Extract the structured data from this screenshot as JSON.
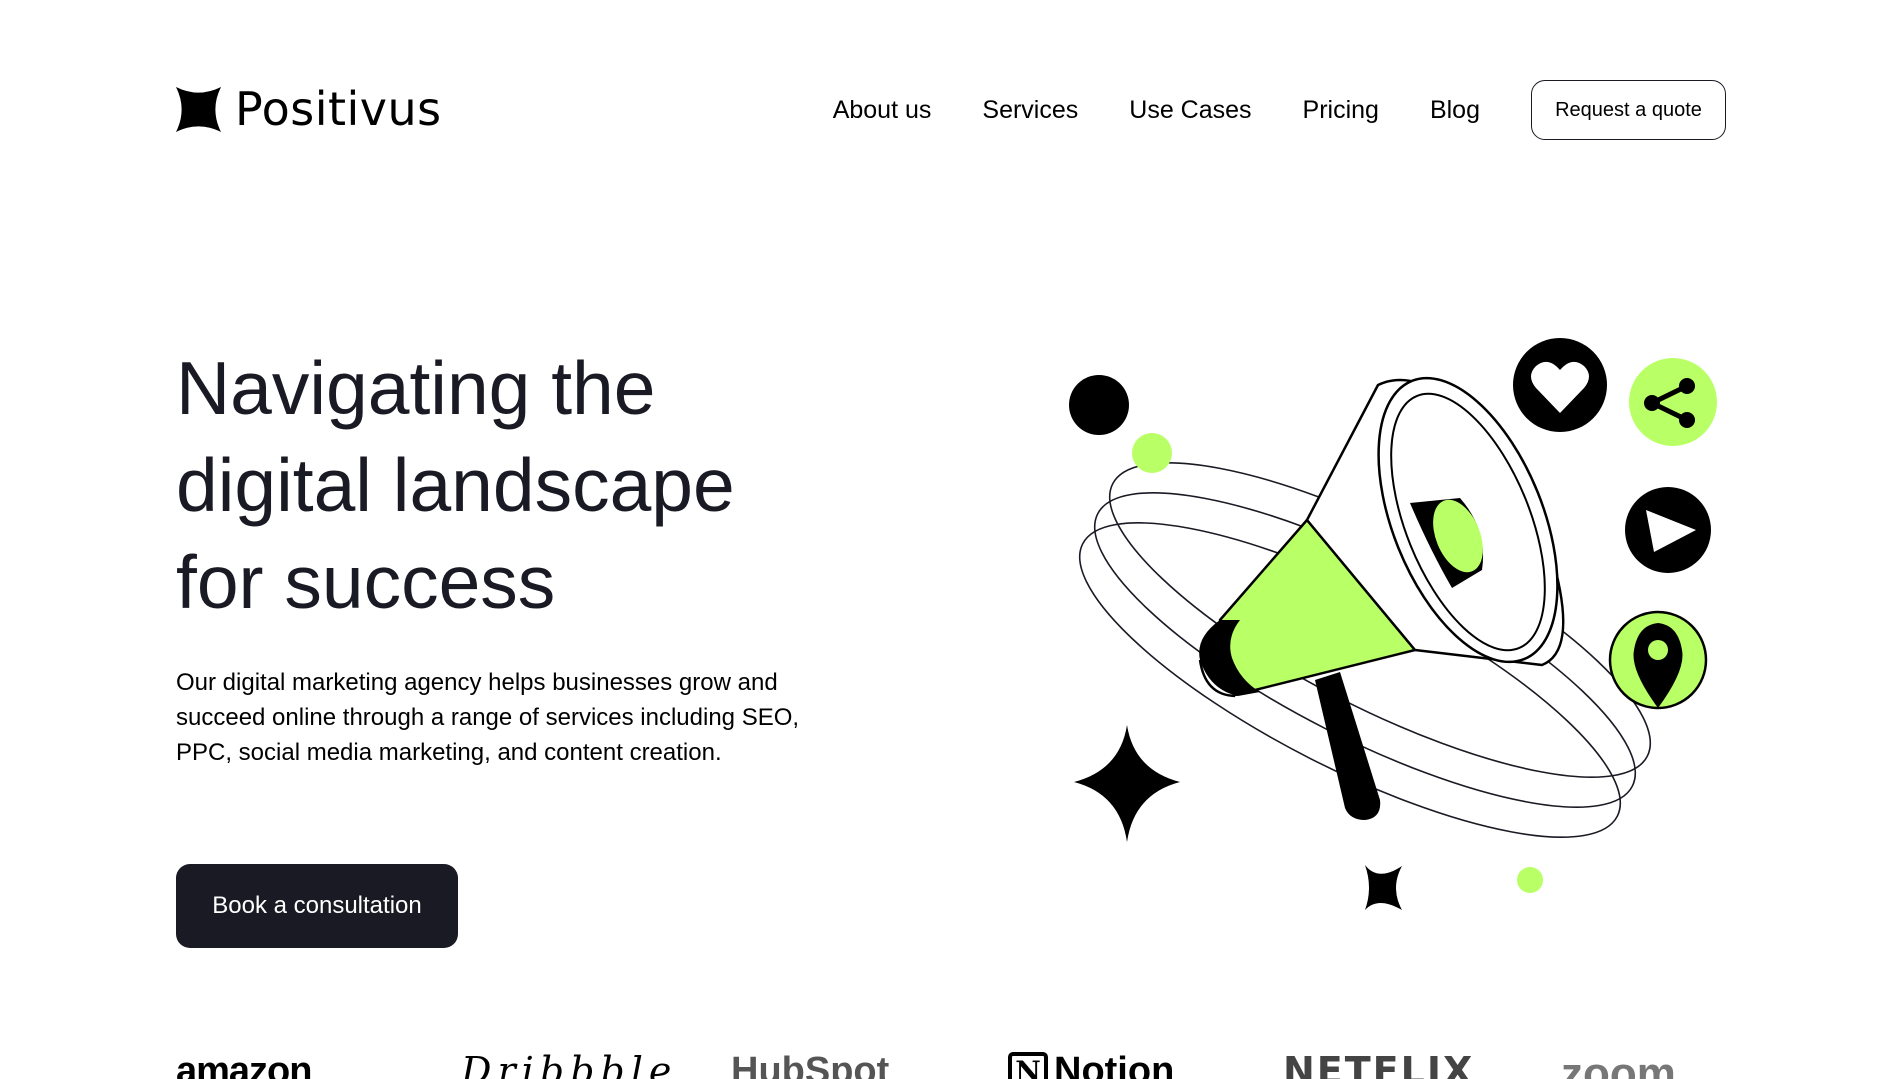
{
  "header": {
    "logo_text": "Positivus",
    "nav": [
      "About us",
      "Services",
      "Use Cases",
      "Pricing",
      "Blog"
    ],
    "quote_button": "Request a quote"
  },
  "hero": {
    "title_lines": [
      "Navigating the",
      "digital landscape",
      "for success"
    ],
    "description": "Our digital marketing agency helps businesses grow and succeed online through a range of services including SEO, PPC, social media marketing, and content creation.",
    "cta": "Book a consultation"
  },
  "illustration": {
    "icons": [
      "megaphone-icon",
      "heart-icon",
      "share-icon",
      "play-icon",
      "location-pin-icon",
      "sparkle-star-icon"
    ]
  },
  "logos": {
    "amazon": "amazon",
    "dribbble": "Dribbble",
    "hubspot": "HubSpot",
    "notion": "Notion",
    "netflix": "NETFLIX",
    "zoom": "zoom"
  },
  "colors": {
    "accent": "#b9ff66",
    "dark": "#191a23",
    "background": "#ffffff"
  }
}
